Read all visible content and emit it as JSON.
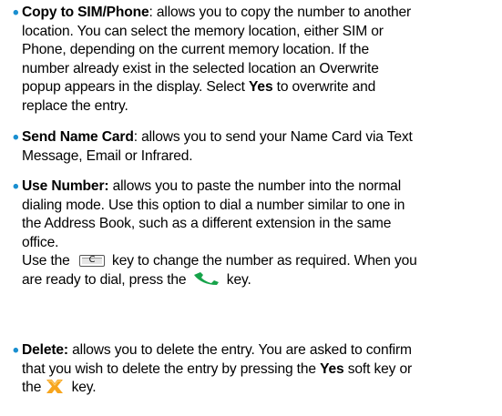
{
  "items": [
    {
      "title": "Copy to SIM/Phone",
      "lines": [
        ": allows you to copy the number to another",
        "location. You can select the memory location, either SIM or",
        "Phone, depending on the current memory location. If the",
        "number already exist in the selected location an Overwrite",
        "popup appears in the display. Select ",
        "Yes",
        " to overwrite and",
        "replace the entry."
      ]
    },
    {
      "title": "Send Name Card",
      "lines": [
        ": allows you to send your Name Card via Text",
        "Message, Email or Infrared."
      ]
    },
    {
      "title": "Use Number:",
      "lines": [
        " allows you to paste the number into the normal",
        "dialing mode. Use this option to dial a number similar to one in",
        "the Address Book, such as a different extension in the same",
        "office.",
        "Use the ",
        " key to change the number as required. When you",
        "are ready to dial, press the ",
        " key."
      ]
    },
    {
      "title": "Delete:",
      "lines": [
        " allows you to delete the entry. You are asked to confirm",
        "that you wish to delete the entry by pressing the ",
        "Yes",
        " soft key or",
        "the ",
        " key."
      ]
    }
  ],
  "bullet_color": "#1a8fd0",
  "icons": {
    "c_key_glyph": "C",
    "c_key_name": "c-key-icon",
    "send_key_name": "send-key-icon",
    "end_key_name": "cancel-key-icon"
  }
}
